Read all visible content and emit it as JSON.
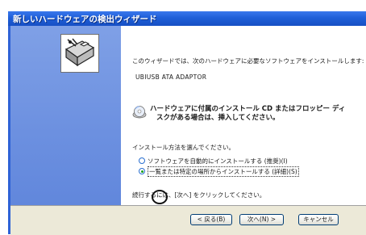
{
  "window": {
    "title": "新しいハードウェアの検出ウィザード"
  },
  "content": {
    "intro": "このウィザードでは、次のハードウェアに必要なソフトウェアをインストールします:",
    "device_name": "UBIUSB ATA ADAPTOR",
    "cd_note_line1": "ハードウェアに付属のインストール CD またはフロッピー ディ",
    "cd_note_line2": "スクがある場合は、挿入してください。",
    "method_prompt": "インストール方法を選んでください。",
    "options": [
      {
        "label": "ソフトウェアを自動的にインストールする (推奨)(I)",
        "selected": false
      },
      {
        "label": "一覧または特定の場所からインストールする (詳細)(S)",
        "selected": true
      }
    ],
    "continue_note": "続行するには、[次へ] をクリックしてください。"
  },
  "footer": {
    "back_label": "< 戻る(B)",
    "next_label": "次へ(N) >",
    "cancel_label": "キャンセル"
  },
  "icons": {
    "wizard": "hardware-wizard-icon",
    "cd": "cd-icon"
  },
  "colors": {
    "titlebar": "#1f5fd8",
    "sidebar": "#6c90e0",
    "footer": "#ece9d8",
    "radio_selected": "#1aa01a"
  }
}
